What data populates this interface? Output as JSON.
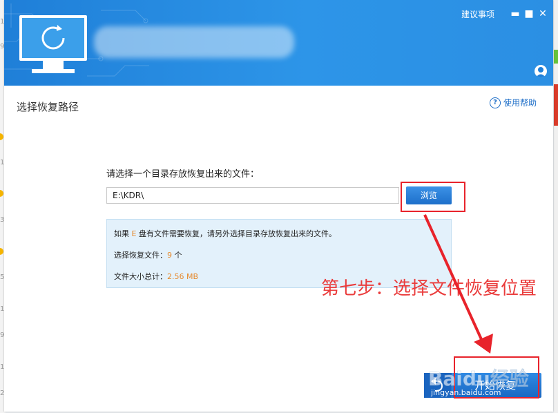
{
  "header": {
    "suggest_label": "建议事项",
    "controls": {
      "minimize": "▬",
      "maximize": "■",
      "close": "✕"
    }
  },
  "page": {
    "title": "选择恢复路径",
    "help_label": "使用帮助"
  },
  "form": {
    "prompt": "请选择一个目录存放恢复出来的文件：",
    "path_value": "E:\\KDR\\",
    "browse_label": "浏览"
  },
  "info": {
    "line1_pre": "如果",
    "line1_drive": "E",
    "line1_post": "盘有文件需要恢复，请另外选择目录存放恢复出来的文件。",
    "files_label": "选择恢复文件：",
    "files_count": "9",
    "files_unit": "个",
    "size_label": "文件大小总计：",
    "size_value": "2.56 MB"
  },
  "annotation": {
    "text": "第七步：选择文件恢复位置",
    "color": "#ea3c3c"
  },
  "footer": {
    "start_label": "开始恢复"
  },
  "watermark": {
    "brand": "Baidu经验",
    "url": "jingyan.baidu.com"
  },
  "background_numbers": [
    "1",
    "9",
    "1",
    "3",
    "5",
    "1",
    "9",
    "1",
    "2"
  ],
  "icons": {
    "logo": "monitor-refresh-icon",
    "help": "question-circle-icon",
    "avatar": "user-avatar-icon",
    "back": "back-arrow-icon"
  },
  "colors": {
    "header": "#2b8fe3",
    "accent_blue": "#1f6fc8",
    "highlight_orange": "#e68a2e",
    "red_box": "#e8232b"
  }
}
